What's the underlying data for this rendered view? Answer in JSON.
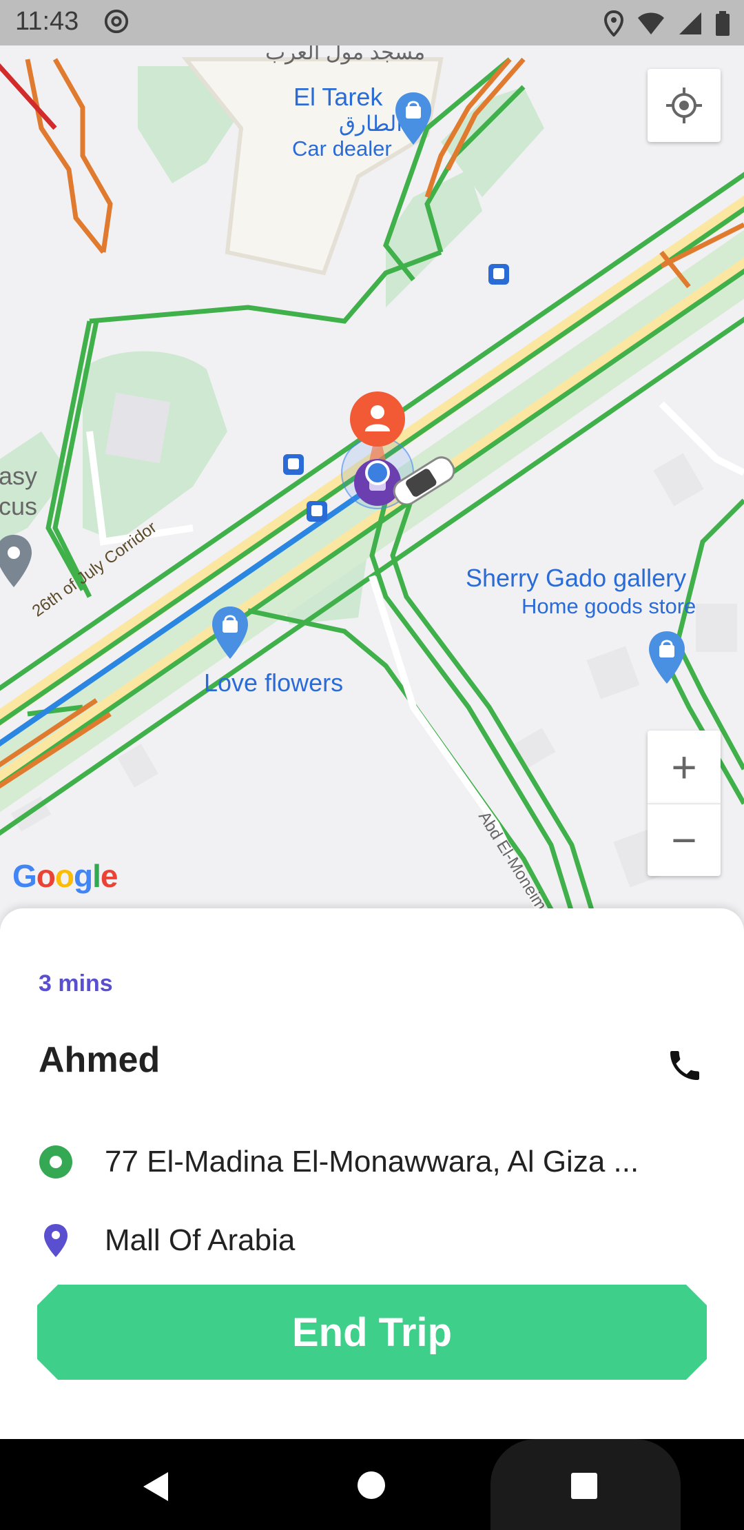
{
  "status_bar": {
    "time": "11:43",
    "icons": [
      "at-sign-icon",
      "location-icon",
      "wifi-icon",
      "signal-icon",
      "battery-icon"
    ]
  },
  "map": {
    "labels": {
      "mosque": "مسجد مول العرب",
      "el_tarek_en": "El Tarek",
      "el_tarek_ar": "الطارق",
      "car_dealer": "Car dealer",
      "sherry_gado": "Sherry Gado gallery",
      "home_goods": "Home goods store",
      "love_flowers": "Love flowers",
      "easy_partial": "asy",
      "cus_partial": "cus",
      "corridor": "26th of July Corridor",
      "abd_street": "Abd El-Moneim Ri"
    },
    "logo": "Google",
    "controls": {
      "locate": "my-location-icon",
      "zoom_in": "+",
      "zoom_out": "−"
    }
  },
  "trip": {
    "eta": "3 mins",
    "driver_name": "Ahmed",
    "pickup": "77 El-Madina El-Monawwara, Al Giza ...",
    "dropoff": "Mall Of Arabia",
    "end_button": "End Trip"
  },
  "colors": {
    "accent_purple": "#5a4fcf",
    "button_green": "#3ecf8a",
    "pickup_green": "#34a853",
    "dropoff_blue": "#5a4fcf",
    "map_label_blue": "#2a6bd6"
  },
  "navbar": {
    "icons": [
      "back-icon",
      "home-icon",
      "recents-icon"
    ]
  }
}
